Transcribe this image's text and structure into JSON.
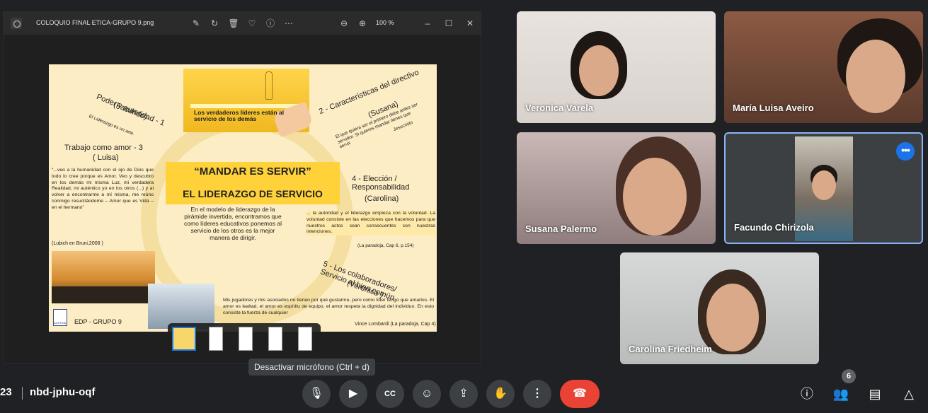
{
  "viewer": {
    "filename": "COLOQUIO FINAL ETICA-GRUPO 9.png",
    "zoom": "100 %",
    "icons": [
      "edit-icon",
      "rotate-icon",
      "delete-icon",
      "favorite-icon",
      "info-icon",
      "more-icon",
      "zoom-out-icon",
      "zoom-in-icon",
      "minimize-icon",
      "maximize-icon",
      "close-icon"
    ]
  },
  "slide": {
    "banner_text": "Los verdaderos líderes están al servicio de los demás",
    "title1": "“MANDAR ES SERVIR”",
    "title2": "EL LIDERAZGO DE SERVICIO",
    "center_paragraph": "En el modelo de liderazgo de la pirámide invertida, encontramos que como líderes educativos ponemos al servicio de los otros es la mejor manera de dirigir.",
    "item1_title": "Poder y autoridad - 1",
    "item1_author": "(Facundo)",
    "item1_note": "El Liderazgo es un arte.",
    "item2_title": "2 - Características del directivo",
    "item2_author": "(Susana)",
    "item2_quote": "El que quiera ser el primero debe antes ser servidor. Si quieres mandar tienes que servir.",
    "item2_source": "Jesucristo",
    "item3_title": "Trabajo como amor - 3",
    "item3_author": "( Luisa)",
    "item3_quote": "“...veo a la humanidad con el ojo de Dios que todo lo cree porque es Amor. Veo y descubro en los demás mi misma Luz, mi verdadera Realidad, mi auténtico yo en los otros (...) y al volver a encontrarme a mí misma, me reúno conmigo resucitándome – Amor que es Vida – en el hermano”",
    "item3_source": "(Lubich en Bruni,2008 )",
    "item4_title": "4 - Elección / Responsabilidad",
    "item4_author": "(Carolina)",
    "item4_quote": "... la autoridad y el liderazgo empieza con la voluntad. La voluntad consiste en las elecciones que hacemos para que nuestros actos sean consecuentes con nuestras intenciones.",
    "item4_source": "(La paradoja, Cap 6, p.154)",
    "item5_title": "5 - Los colaboradores/ Servicio al bien común",
    "item5_author": "(Verónica )",
    "item5_quote": "Mis jugadores y mis asociados no tienen por qué gustarme, pero como líder tengo que amarlos. El amor es lealtad, el amor es espíritu de equipo, el amor respeta la dignidad del individuo. En esto consiste la fuerza de cualquier",
    "item5_source": "Vince Lombardi (La paradoja, Cap 4)",
    "logo_text": "AUSTRAL",
    "footer": "EDP - GRUPO 9"
  },
  "participants": [
    {
      "name": "Veronica Varela"
    },
    {
      "name": "María Luisa Aveiro"
    },
    {
      "name": "Susana Palermo"
    },
    {
      "name": "Facundo Chirizola"
    },
    {
      "name": "Carolina Friedheim"
    }
  ],
  "tooltip": "Desactivar micrófono (Ctrl + d)",
  "bottombar": {
    "time": "23",
    "meeting_code": "nbd-jphu-oqf",
    "participant_count": "6"
  }
}
